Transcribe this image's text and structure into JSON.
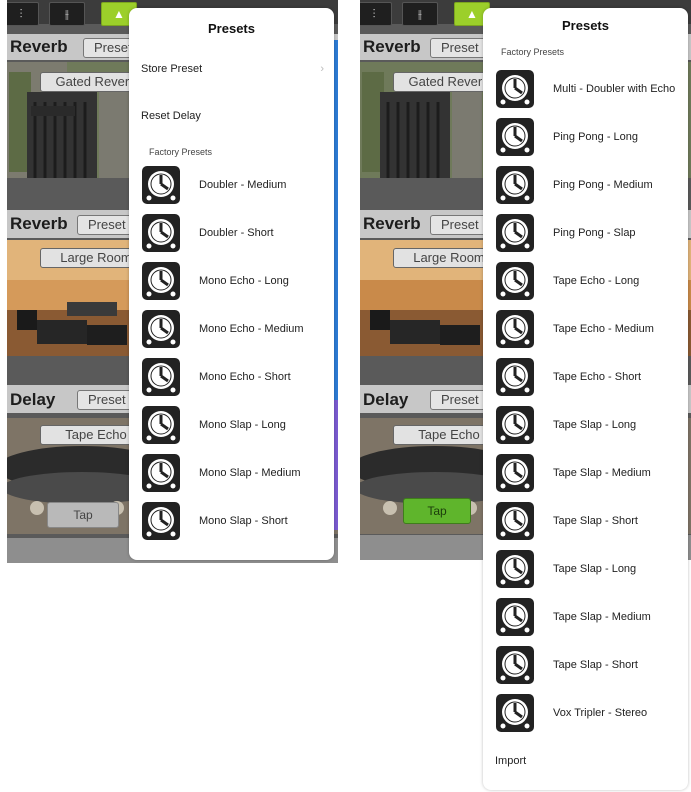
{
  "colors": {
    "accent_green": "#9ccf2a",
    "tap_green": "#5fb52c",
    "panel_bg": "#5a5a5a",
    "side_blue": "#2d7bd4",
    "side_purple": "#7a5bd0"
  },
  "left": {
    "sections": [
      {
        "label": "Reverb",
        "preset_label": "Preset",
        "photo_label": "Gated Reverb"
      },
      {
        "label": "Reverb",
        "preset_label": "Preset",
        "photo_label": "Large Room"
      },
      {
        "label": "Delay",
        "preset_label": "Preset",
        "photo_label": "Tape Echo"
      }
    ],
    "tap_label": "Tap",
    "popover": {
      "title": "Presets",
      "store_preset": "Store Preset",
      "reset_delay": "Reset Delay",
      "factory_header": "Factory Presets",
      "items": [
        "Doubler - Medium",
        "Doubler - Short",
        "Mono Echo - Long",
        "Mono Echo - Medium",
        "Mono Echo - Short",
        "Mono Slap - Long",
        "Mono Slap - Medium",
        "Mono Slap - Short"
      ]
    }
  },
  "right": {
    "sections": [
      {
        "label": "Reverb",
        "preset_label": "Preset",
        "photo_label": "Gated Reverb"
      },
      {
        "label": "Reverb",
        "preset_label": "Preset",
        "photo_label": "Large Room"
      },
      {
        "label": "Delay",
        "preset_label": "Preset",
        "photo_label": "Tape Echo"
      }
    ],
    "tap_label": "Tap",
    "popover": {
      "title": "Presets",
      "factory_header": "Factory Presets",
      "items": [
        "Multi - Doubler with Echo",
        "Ping Pong - Long",
        "Ping Pong - Medium",
        "Ping Pong - Slap",
        "Tape Echo - Long",
        "Tape Echo - Medium",
        "Tape Echo - Short",
        "Tape Slap - Long",
        "Tape Slap - Medium",
        "Tape Slap - Short",
        "Tape Slap - Long",
        "Tape Slap - Medium",
        "Tape Slap - Short",
        "Vox Tripler - Stereo"
      ],
      "import": "Import"
    }
  },
  "icons": {
    "top_buttons": [
      "mixer-icon",
      "fader-icon",
      "plugin-icon"
    ],
    "preset_item": "clock-icon"
  }
}
